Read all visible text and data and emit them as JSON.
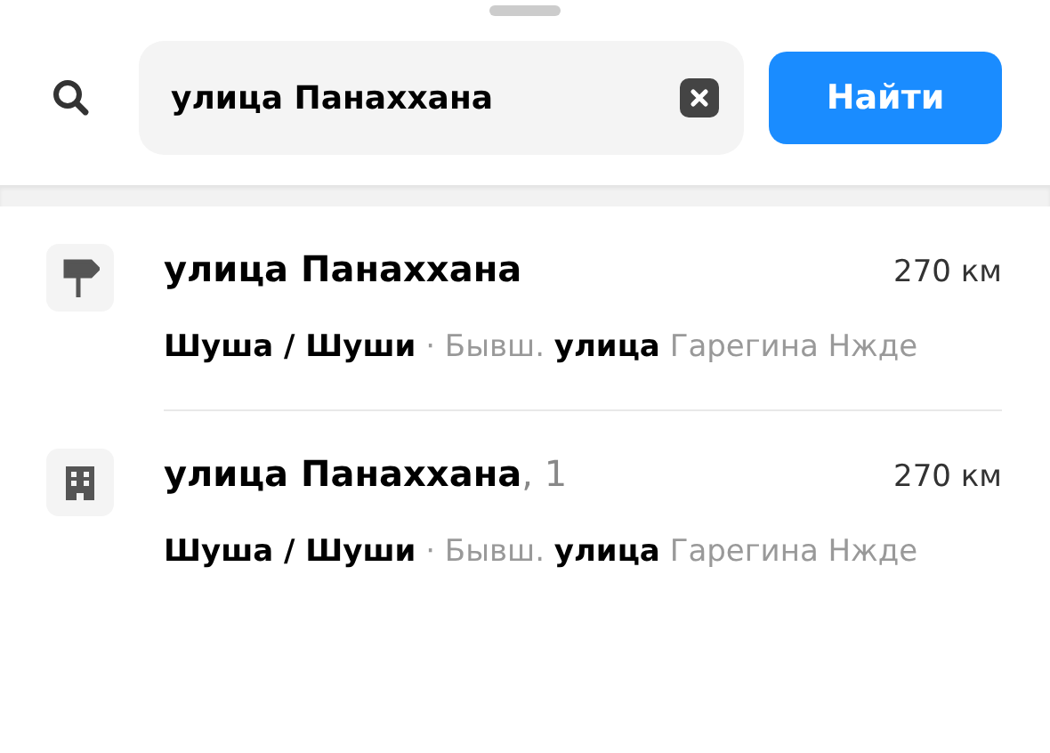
{
  "search": {
    "value": "улица Панаххана",
    "button": "Найти"
  },
  "results": [
    {
      "kind": "street",
      "title": "улица Панаххана",
      "distance": "270 км",
      "subtitle": "**Шуша / Шуши** · Бывш. **улица** Гарегина Нжде"
    },
    {
      "kind": "building",
      "title": "улица Панаххана",
      "suffix": ", 1",
      "distance": "270 км",
      "subtitle": "**Шуша / Шуши** · Бывш. **улица** Гарегина Нжде"
    }
  ]
}
